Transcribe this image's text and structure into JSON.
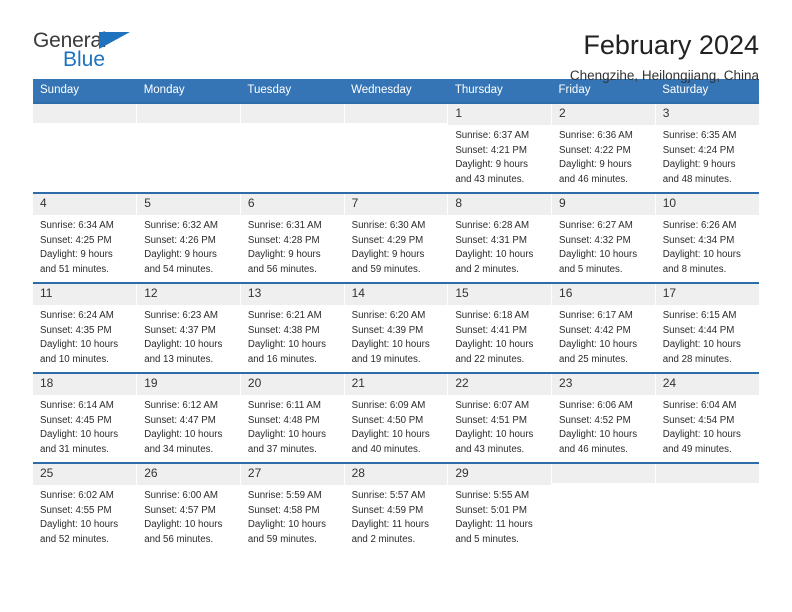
{
  "brand": {
    "name_top": "General",
    "name_bottom": "Blue",
    "triangle_color": "#1f72bd",
    "text_color": "#3a3a3a"
  },
  "header": {
    "title": "February 2024",
    "subtitle": "Chengzihe, Heilongjiang, China"
  },
  "theme": {
    "header_blue": "#3575b6",
    "row_border_blue": "#2d6ca8",
    "daynum_bg": "#efefef"
  },
  "weekday_headers": [
    "Sunday",
    "Monday",
    "Tuesday",
    "Wednesday",
    "Thursday",
    "Friday",
    "Saturday"
  ],
  "labels": {
    "sunrise_prefix": "Sunrise:",
    "sunset_prefix": "Sunset:",
    "daylight_prefix": "Daylight:"
  },
  "weeks": [
    [
      {
        "day": "",
        "blank": true
      },
      {
        "day": "",
        "blank": true
      },
      {
        "day": "",
        "blank": true
      },
      {
        "day": "",
        "blank": true
      },
      {
        "day": "1",
        "sunrise": "Sunrise: 6:37 AM",
        "sunset": "Sunset: 4:21 PM",
        "daylight_1": "Daylight: 9 hours",
        "daylight_2": "and 43 minutes."
      },
      {
        "day": "2",
        "sunrise": "Sunrise: 6:36 AM",
        "sunset": "Sunset: 4:22 PM",
        "daylight_1": "Daylight: 9 hours",
        "daylight_2": "and 46 minutes."
      },
      {
        "day": "3",
        "sunrise": "Sunrise: 6:35 AM",
        "sunset": "Sunset: 4:24 PM",
        "daylight_1": "Daylight: 9 hours",
        "daylight_2": "and 48 minutes."
      }
    ],
    [
      {
        "day": "4",
        "sunrise": "Sunrise: 6:34 AM",
        "sunset": "Sunset: 4:25 PM",
        "daylight_1": "Daylight: 9 hours",
        "daylight_2": "and 51 minutes."
      },
      {
        "day": "5",
        "sunrise": "Sunrise: 6:32 AM",
        "sunset": "Sunset: 4:26 PM",
        "daylight_1": "Daylight: 9 hours",
        "daylight_2": "and 54 minutes."
      },
      {
        "day": "6",
        "sunrise": "Sunrise: 6:31 AM",
        "sunset": "Sunset: 4:28 PM",
        "daylight_1": "Daylight: 9 hours",
        "daylight_2": "and 56 minutes."
      },
      {
        "day": "7",
        "sunrise": "Sunrise: 6:30 AM",
        "sunset": "Sunset: 4:29 PM",
        "daylight_1": "Daylight: 9 hours",
        "daylight_2": "and 59 minutes."
      },
      {
        "day": "8",
        "sunrise": "Sunrise: 6:28 AM",
        "sunset": "Sunset: 4:31 PM",
        "daylight_1": "Daylight: 10 hours",
        "daylight_2": "and 2 minutes."
      },
      {
        "day": "9",
        "sunrise": "Sunrise: 6:27 AM",
        "sunset": "Sunset: 4:32 PM",
        "daylight_1": "Daylight: 10 hours",
        "daylight_2": "and 5 minutes."
      },
      {
        "day": "10",
        "sunrise": "Sunrise: 6:26 AM",
        "sunset": "Sunset: 4:34 PM",
        "daylight_1": "Daylight: 10 hours",
        "daylight_2": "and 8 minutes."
      }
    ],
    [
      {
        "day": "11",
        "sunrise": "Sunrise: 6:24 AM",
        "sunset": "Sunset: 4:35 PM",
        "daylight_1": "Daylight: 10 hours",
        "daylight_2": "and 10 minutes."
      },
      {
        "day": "12",
        "sunrise": "Sunrise: 6:23 AM",
        "sunset": "Sunset: 4:37 PM",
        "daylight_1": "Daylight: 10 hours",
        "daylight_2": "and 13 minutes."
      },
      {
        "day": "13",
        "sunrise": "Sunrise: 6:21 AM",
        "sunset": "Sunset: 4:38 PM",
        "daylight_1": "Daylight: 10 hours",
        "daylight_2": "and 16 minutes."
      },
      {
        "day": "14",
        "sunrise": "Sunrise: 6:20 AM",
        "sunset": "Sunset: 4:39 PM",
        "daylight_1": "Daylight: 10 hours",
        "daylight_2": "and 19 minutes."
      },
      {
        "day": "15",
        "sunrise": "Sunrise: 6:18 AM",
        "sunset": "Sunset: 4:41 PM",
        "daylight_1": "Daylight: 10 hours",
        "daylight_2": "and 22 minutes."
      },
      {
        "day": "16",
        "sunrise": "Sunrise: 6:17 AM",
        "sunset": "Sunset: 4:42 PM",
        "daylight_1": "Daylight: 10 hours",
        "daylight_2": "and 25 minutes."
      },
      {
        "day": "17",
        "sunrise": "Sunrise: 6:15 AM",
        "sunset": "Sunset: 4:44 PM",
        "daylight_1": "Daylight: 10 hours",
        "daylight_2": "and 28 minutes."
      }
    ],
    [
      {
        "day": "18",
        "sunrise": "Sunrise: 6:14 AM",
        "sunset": "Sunset: 4:45 PM",
        "daylight_1": "Daylight: 10 hours",
        "daylight_2": "and 31 minutes."
      },
      {
        "day": "19",
        "sunrise": "Sunrise: 6:12 AM",
        "sunset": "Sunset: 4:47 PM",
        "daylight_1": "Daylight: 10 hours",
        "daylight_2": "and 34 minutes."
      },
      {
        "day": "20",
        "sunrise": "Sunrise: 6:11 AM",
        "sunset": "Sunset: 4:48 PM",
        "daylight_1": "Daylight: 10 hours",
        "daylight_2": "and 37 minutes."
      },
      {
        "day": "21",
        "sunrise": "Sunrise: 6:09 AM",
        "sunset": "Sunset: 4:50 PM",
        "daylight_1": "Daylight: 10 hours",
        "daylight_2": "and 40 minutes."
      },
      {
        "day": "22",
        "sunrise": "Sunrise: 6:07 AM",
        "sunset": "Sunset: 4:51 PM",
        "daylight_1": "Daylight: 10 hours",
        "daylight_2": "and 43 minutes."
      },
      {
        "day": "23",
        "sunrise": "Sunrise: 6:06 AM",
        "sunset": "Sunset: 4:52 PM",
        "daylight_1": "Daylight: 10 hours",
        "daylight_2": "and 46 minutes."
      },
      {
        "day": "24",
        "sunrise": "Sunrise: 6:04 AM",
        "sunset": "Sunset: 4:54 PM",
        "daylight_1": "Daylight: 10 hours",
        "daylight_2": "and 49 minutes."
      }
    ],
    [
      {
        "day": "25",
        "sunrise": "Sunrise: 6:02 AM",
        "sunset": "Sunset: 4:55 PM",
        "daylight_1": "Daylight: 10 hours",
        "daylight_2": "and 52 minutes."
      },
      {
        "day": "26",
        "sunrise": "Sunrise: 6:00 AM",
        "sunset": "Sunset: 4:57 PM",
        "daylight_1": "Daylight: 10 hours",
        "daylight_2": "and 56 minutes."
      },
      {
        "day": "27",
        "sunrise": "Sunrise: 5:59 AM",
        "sunset": "Sunset: 4:58 PM",
        "daylight_1": "Daylight: 10 hours",
        "daylight_2": "and 59 minutes."
      },
      {
        "day": "28",
        "sunrise": "Sunrise: 5:57 AM",
        "sunset": "Sunset: 4:59 PM",
        "daylight_1": "Daylight: 11 hours",
        "daylight_2": "and 2 minutes."
      },
      {
        "day": "29",
        "sunrise": "Sunrise: 5:55 AM",
        "sunset": "Sunset: 5:01 PM",
        "daylight_1": "Daylight: 11 hours",
        "daylight_2": "and 5 minutes."
      },
      {
        "day": "",
        "blank": true
      },
      {
        "day": "",
        "blank": true
      }
    ]
  ]
}
